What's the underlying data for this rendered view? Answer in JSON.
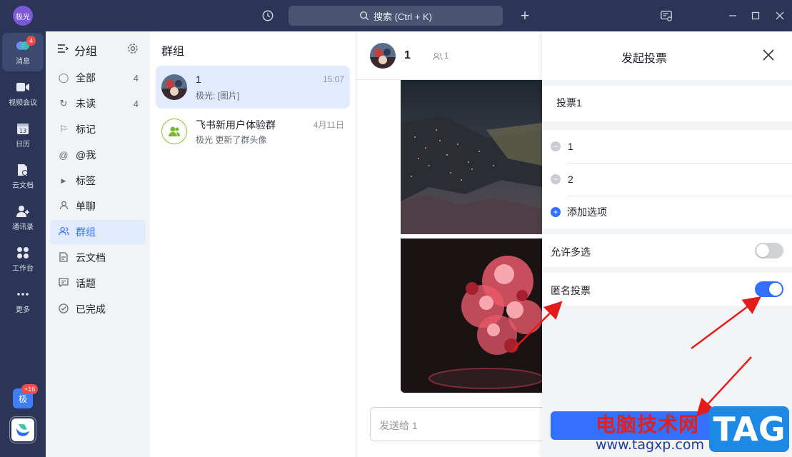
{
  "top": {
    "user_initials": "极光",
    "search_placeholder": "搜索 (Ctrl + K)"
  },
  "rail": {
    "items": [
      {
        "label": "消息",
        "badge": "4",
        "icon": "message-icon"
      },
      {
        "label": "视频会议",
        "icon": "video-icon"
      },
      {
        "label": "日历",
        "icon": "calendar-icon"
      },
      {
        "label": "云文档",
        "icon": "cloud-doc-icon"
      },
      {
        "label": "通讯录",
        "icon": "contacts-icon"
      },
      {
        "label": "工作台",
        "icon": "workspace-icon"
      },
      {
        "label": "更多",
        "icon": "more-icon"
      }
    ],
    "bottom_avatar_text": "极",
    "bottom_badge": "+16"
  },
  "sidebar": {
    "title": "分组",
    "items": [
      {
        "label": "全部",
        "count": "4",
        "icon": "all-icon"
      },
      {
        "label": "未读",
        "count": "4",
        "icon": "unread-icon"
      },
      {
        "label": "标记",
        "icon": "flag-icon"
      },
      {
        "label": "@我",
        "icon": "at-icon"
      },
      {
        "label": "标签",
        "icon": "caret-right-icon"
      },
      {
        "label": "单聊",
        "icon": "person-icon"
      },
      {
        "label": "群组",
        "icon": "group-icon"
      },
      {
        "label": "云文档",
        "icon": "doc-icon"
      },
      {
        "label": "话题",
        "icon": "topic-icon"
      },
      {
        "label": "已完成",
        "icon": "check-icon"
      }
    ]
  },
  "list": {
    "title": "群组",
    "chats": [
      {
        "name": "1",
        "time": "15:07",
        "preview": "极光: [图片]"
      },
      {
        "name": "飞书新用户体验群",
        "time": "4月11日",
        "preview": "极光 更新了群头像"
      }
    ]
  },
  "chat": {
    "name": "1",
    "member_count": "1",
    "compose_placeholder": "发送给 1"
  },
  "vote_panel": {
    "title": "发起投票",
    "vote_title": "投票1",
    "options": [
      "1",
      "2"
    ],
    "add_option_label": "添加选项",
    "allow_multiple_label": "允许多选",
    "allow_multiple": false,
    "anonymous_label": "匿名投票",
    "anonymous": true,
    "accent": "#3370ff"
  },
  "watermark": {
    "text": "电脑技术网",
    "url": "www.tagxp.com",
    "tag": "TAG"
  }
}
